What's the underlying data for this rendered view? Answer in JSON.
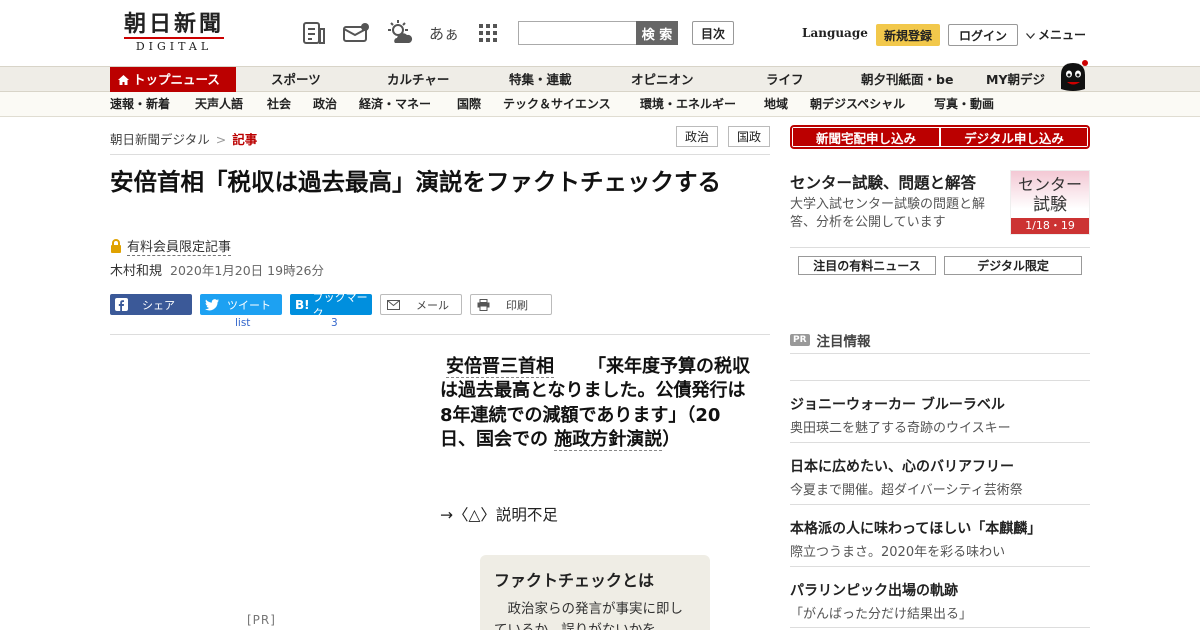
{
  "header": {
    "logo_main": "朝日新聞",
    "logo_sub": "DIGITAL",
    "search_placeholder": "",
    "search_button": "検 索",
    "toc_button": "目次",
    "language": "Language",
    "register": "新規登録",
    "login": "ログイン",
    "menu": "メニュー",
    "font_icon_label": "あぁ"
  },
  "nav_primary": [
    "トップニュース",
    "スポーツ",
    "カルチャー",
    "特集・連載",
    "オピニオン",
    "ライフ",
    "朝夕刊紙面・be",
    "MY朝デジ"
  ],
  "nav_secondary": [
    "速報・新着",
    "天声人語",
    "社会",
    "政治",
    "経済・マネー",
    "国際",
    "テック＆サイエンス",
    "環境・エネルギー",
    "地域",
    "朝デジスペシャル",
    "写真・動画"
  ],
  "breadcrumb": {
    "home": "朝日新聞デジタル",
    "sep": ">",
    "current": "記事"
  },
  "tags": [
    "政治",
    "国政"
  ],
  "article": {
    "headline": "安倍首相「税収は過去最高」演説をファクトチェックする",
    "members_only": "有料会員限定記事",
    "author": "木村和規",
    "date": "2020年1月20日 19時26分",
    "share": {
      "facebook": "シェア",
      "twitter": "ツイート",
      "twitter_count": "list",
      "hatena": "ブックマーク",
      "hatena_count": "3",
      "mail": "メール",
      "print": "印刷"
    },
    "pr_label": "[PR]",
    "quote_speaker": "安倍晋三首相",
    "quote_body": "「来年度予算の税収は過去最高となりました。公債発行は8年連続での減額であります」（20日、国会での",
    "quote_link": "施政方針演説",
    "quote_end": "）",
    "verdict": "→〈△〉説明不足",
    "factbox_title": "ファクトチェックとは",
    "factbox_text": "政治家らの発言が事実に即しているか、誤りがないかを"
  },
  "sidebar": {
    "subscribe_paper": "新聞宅配申し込み",
    "subscribe_digital": "デジタル申し込み",
    "exam_title": "センター試験、問題と解答",
    "exam_desc": "大学入試センター試験の問題と解答、分析を公開しています",
    "exam_img_line1": "センター",
    "exam_img_line2": "試験",
    "exam_img_date": "1/18・19",
    "btn_paid_news": "注目の有料ニュース",
    "btn_digital_only": "デジタル限定",
    "featured_badge": "PR",
    "featured_title": "注目情報",
    "ads": [
      {
        "title": "ジョニーウォーカー ブルーラベル",
        "sub": "奥田瑛二を魅了する奇跡のウイスキー"
      },
      {
        "title": "日本に広めたい、心のバリアフリー",
        "sub": "今夏まで開催。超ダイバーシティ芸術祭"
      },
      {
        "title": "本格派の人に味わってほしい「本麒麟」",
        "sub": "際立つうまさ。2020年を彩る味わい"
      },
      {
        "title": "パラリンピック出場の軌跡",
        "sub": "「がんばった分だけ結果出る」"
      }
    ]
  },
  "colors": {
    "brand_red": "#bb0000",
    "register_yellow": "#f2c84b",
    "facebook": "#3b5998",
    "twitter": "#1da1f2",
    "hatena": "#008fde"
  }
}
